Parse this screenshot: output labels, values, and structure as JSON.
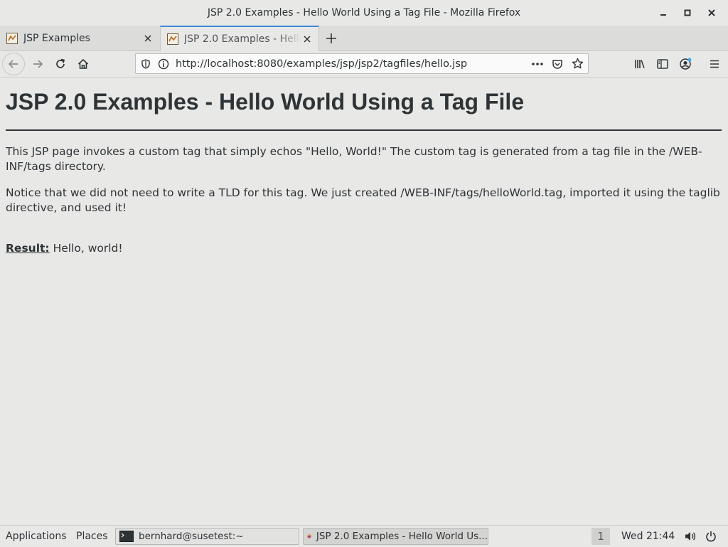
{
  "window": {
    "title": "JSP 2.0 Examples - Hello World Using a Tag File - Mozilla Firefox"
  },
  "tabs": [
    {
      "label": "JSP Examples",
      "active": false
    },
    {
      "label": "JSP 2.0 Examples - Hello World Using a Tag File",
      "active": true
    }
  ],
  "url": "http://localhost:8080/examples/jsp/jsp2/tagfiles/hello.jsp",
  "page": {
    "heading": "JSP 2.0 Examples - Hello World Using a Tag File",
    "paragraph1": "This JSP page invokes a custom tag that simply echos \"Hello, World!\" The custom tag is generated from a tag file in the /WEB-INF/tags directory.",
    "paragraph2": "Notice that we did not need to write a TLD for this tag. We just created /WEB-INF/tags/helloWorld.tag, imported it using the taglib directive, and used it!",
    "result_label": "Result:",
    "result_value": " Hello, world!"
  },
  "taskbar": {
    "applications": "Applications",
    "places": "Places",
    "windows": [
      {
        "label": "bernhard@susetest:~",
        "icon": "terminal-icon"
      },
      {
        "label": "JSP 2.0 Examples - Hello World Us...",
        "icon": "firefox-icon"
      }
    ],
    "workspace": "1",
    "clock": "Wed 21:44"
  },
  "colors": {
    "background": "#e8e8e7",
    "text": "#2e3436",
    "tab_accent": "#3d86d6",
    "notification_dot": "#3daee9"
  }
}
